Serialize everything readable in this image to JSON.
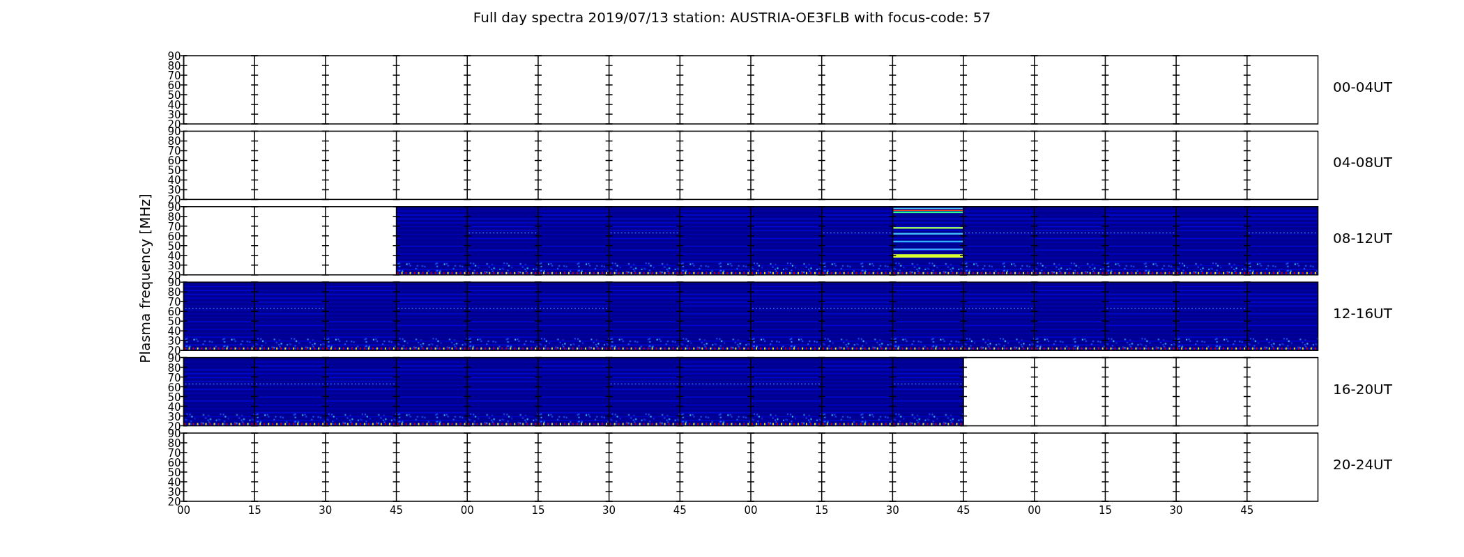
{
  "title": "Full day spectra 2019/07/13 station: AUSTRIA-OE3FLB with focus-code: 57",
  "ylabel": "Plasma frequency [MHz]",
  "panels": [
    {
      "label": "00-04UT",
      "yticks": [
        "90",
        "80",
        "70",
        "60",
        "50",
        "40",
        "30",
        "20"
      ],
      "segments": [
        {
          "kind": "empty"
        },
        {
          "kind": "empty"
        },
        {
          "kind": "empty"
        },
        {
          "kind": "empty"
        },
        {
          "kind": "empty"
        },
        {
          "kind": "empty"
        },
        {
          "kind": "empty"
        },
        {
          "kind": "empty"
        },
        {
          "kind": "empty"
        },
        {
          "kind": "empty"
        },
        {
          "kind": "empty"
        },
        {
          "kind": "empty"
        },
        {
          "kind": "empty"
        },
        {
          "kind": "empty"
        },
        {
          "kind": "empty"
        },
        {
          "kind": "empty"
        }
      ]
    },
    {
      "label": "04-08UT",
      "yticks": [
        "90",
        "80",
        "70",
        "60",
        "50",
        "40",
        "30",
        "20"
      ],
      "segments": [
        {
          "kind": "empty"
        },
        {
          "kind": "empty"
        },
        {
          "kind": "empty"
        },
        {
          "kind": "empty"
        },
        {
          "kind": "empty"
        },
        {
          "kind": "empty"
        },
        {
          "kind": "empty"
        },
        {
          "kind": "empty"
        },
        {
          "kind": "empty"
        },
        {
          "kind": "empty"
        },
        {
          "kind": "empty"
        },
        {
          "kind": "empty"
        },
        {
          "kind": "empty"
        },
        {
          "kind": "empty"
        },
        {
          "kind": "empty"
        },
        {
          "kind": "empty"
        }
      ]
    },
    {
      "label": "08-12UT",
      "yticks": [
        "90",
        "80",
        "70",
        "60",
        "50",
        "40",
        "30",
        "20"
      ],
      "segments": [
        {
          "kind": "empty"
        },
        {
          "kind": "empty"
        },
        {
          "kind": "empty"
        },
        {
          "kind": "noise"
        },
        {
          "kind": "noise"
        },
        {
          "kind": "noise"
        },
        {
          "kind": "noise"
        },
        {
          "kind": "noise"
        },
        {
          "kind": "noise"
        },
        {
          "kind": "noise"
        },
        {
          "kind": "burst"
        },
        {
          "kind": "noise"
        },
        {
          "kind": "noise"
        },
        {
          "kind": "noise"
        },
        {
          "kind": "noise"
        },
        {
          "kind": "noise"
        }
      ]
    },
    {
      "label": "12-16UT",
      "yticks": [
        "90",
        "80",
        "70",
        "60",
        "50",
        "40",
        "30",
        "20"
      ],
      "segments": [
        {
          "kind": "noise"
        },
        {
          "kind": "noise"
        },
        {
          "kind": "noise"
        },
        {
          "kind": "noise"
        },
        {
          "kind": "noise"
        },
        {
          "kind": "noise"
        },
        {
          "kind": "noise"
        },
        {
          "kind": "noise"
        },
        {
          "kind": "noise"
        },
        {
          "kind": "noise"
        },
        {
          "kind": "noise"
        },
        {
          "kind": "noise"
        },
        {
          "kind": "noise"
        },
        {
          "kind": "noise"
        },
        {
          "kind": "noise"
        },
        {
          "kind": "noise"
        }
      ]
    },
    {
      "label": "16-20UT",
      "yticks": [
        "90",
        "80",
        "70",
        "60",
        "50",
        "40",
        "30",
        "20"
      ],
      "segments": [
        {
          "kind": "noise"
        },
        {
          "kind": "noise"
        },
        {
          "kind": "noise"
        },
        {
          "kind": "noise"
        },
        {
          "kind": "noise"
        },
        {
          "kind": "noise"
        },
        {
          "kind": "noise"
        },
        {
          "kind": "noise"
        },
        {
          "kind": "noise"
        },
        {
          "kind": "noise"
        },
        {
          "kind": "noise"
        },
        {
          "kind": "empty"
        },
        {
          "kind": "empty"
        },
        {
          "kind": "empty"
        },
        {
          "kind": "empty"
        },
        {
          "kind": "empty"
        }
      ]
    },
    {
      "label": "20-24UT",
      "yticks": [
        "90",
        "80",
        "70",
        "60",
        "50",
        "40",
        "30",
        "20"
      ],
      "segments": [
        {
          "kind": "empty"
        },
        {
          "kind": "empty"
        },
        {
          "kind": "empty"
        },
        {
          "kind": "empty"
        },
        {
          "kind": "empty"
        },
        {
          "kind": "empty"
        },
        {
          "kind": "empty"
        },
        {
          "kind": "empty"
        },
        {
          "kind": "empty"
        },
        {
          "kind": "empty"
        },
        {
          "kind": "empty"
        },
        {
          "kind": "empty"
        },
        {
          "kind": "empty"
        },
        {
          "kind": "empty"
        },
        {
          "kind": "empty"
        },
        {
          "kind": "empty"
        }
      ]
    }
  ],
  "xticks": [
    "00",
    "15",
    "30",
    "45",
    "00",
    "15",
    "30",
    "45",
    "00",
    "15",
    "30",
    "45",
    "00",
    "15",
    "30",
    "45"
  ]
}
